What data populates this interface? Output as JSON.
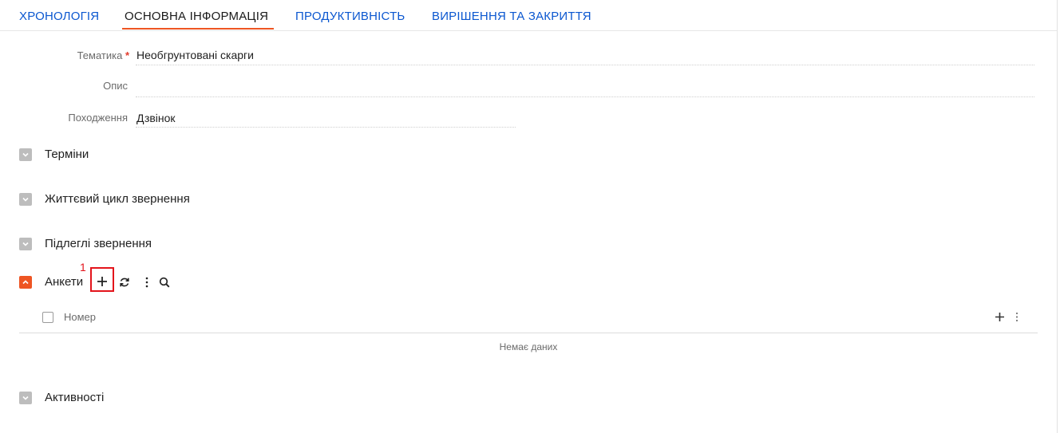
{
  "tabs": [
    {
      "label": "ХРОНОЛОГІЯ"
    },
    {
      "label": "ОСНОВНА ІНФОРМАЦІЯ",
      "active": true
    },
    {
      "label": "ПРОДУКТИВНІСТЬ"
    },
    {
      "label": "ВИРІШЕННЯ ТА ЗАКРИТТЯ"
    }
  ],
  "fields": {
    "topic": {
      "label": "Тематика",
      "required_mark": "*",
      "value": "Необгрунтовані скарги"
    },
    "description": {
      "label": "Опис",
      "value": ""
    },
    "origin": {
      "label": "Походження",
      "value": "Дзвінок"
    }
  },
  "sections": {
    "terms": {
      "title": "Терміни",
      "expanded": false
    },
    "lifecycle": {
      "title": "Життєвий цикл звернення",
      "expanded": false
    },
    "subordinate": {
      "title": "Підлеглі звернення",
      "expanded": false
    },
    "questionnaires": {
      "title": "Анкети",
      "expanded": true
    },
    "activities": {
      "title": "Активності",
      "expanded": false
    }
  },
  "questionnaires_grid": {
    "column_header": "Номер",
    "empty_text": "Немає даних"
  },
  "annotation": {
    "label": "1"
  },
  "colors": {
    "accent": "#ee5523",
    "link": "#0b57d0",
    "highlight": "#e3141b",
    "toggle_collapsed": "#bdbdbd"
  },
  "icons": {
    "add": "plus-icon",
    "refresh": "refresh-icon",
    "more": "vertical-dots-icon",
    "search": "search-icon",
    "toggle_collapsed": "chevron-down-icon",
    "toggle_expanded": "chevron-up-icon"
  }
}
